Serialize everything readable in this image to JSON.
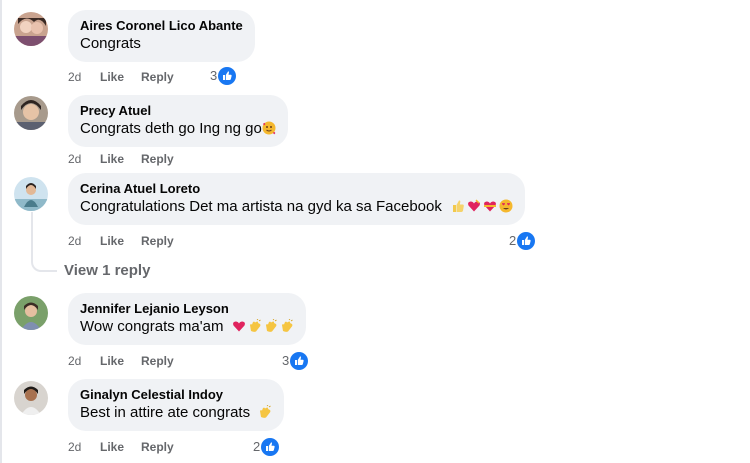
{
  "comments": [
    {
      "author": "Aires Coronel Lico Abante",
      "text": "Congrats",
      "time": "2d",
      "like": "Like",
      "reply": "Reply",
      "reactions": "3",
      "emojis": []
    },
    {
      "author": "Precy Atuel",
      "text": "Congrats deth go Ing ng go",
      "time": "2d",
      "like": "Like",
      "reply": "Reply",
      "reactions": "",
      "emojis": [
        "smiling-face-with-hearts"
      ]
    },
    {
      "author": "Cerina Atuel Loreto",
      "text": "Congratulations Det ma artista na gyd ka sa Facebook",
      "time": "2d",
      "like": "Like",
      "reply": "Reply",
      "reactions": "2",
      "emojis": [
        "thumbs-up",
        "heart-with-ribbon",
        "heart-with-ribbon",
        "heart-eyes"
      ]
    },
    {
      "author": "Jennifer Lejanio Leyson",
      "text": "Wow congrats ma'am",
      "time": "2d",
      "like": "Like",
      "reply": "Reply",
      "reactions": "3",
      "emojis": [
        "red-heart",
        "clapping-hands",
        "clapping-hands",
        "clapping-hands"
      ]
    },
    {
      "author": "Ginalyn Celestial Indoy",
      "text": "Best in attire ate congrats",
      "time": "2d",
      "like": "Like",
      "reply": "Reply",
      "reactions": "2",
      "emojis": [
        "clapping-hands"
      ]
    }
  ],
  "view_replies": "View 1 reply",
  "colors": {
    "bubble": "#f0f2f5",
    "meta": "#65676b",
    "like_blue": "#1877f2"
  }
}
